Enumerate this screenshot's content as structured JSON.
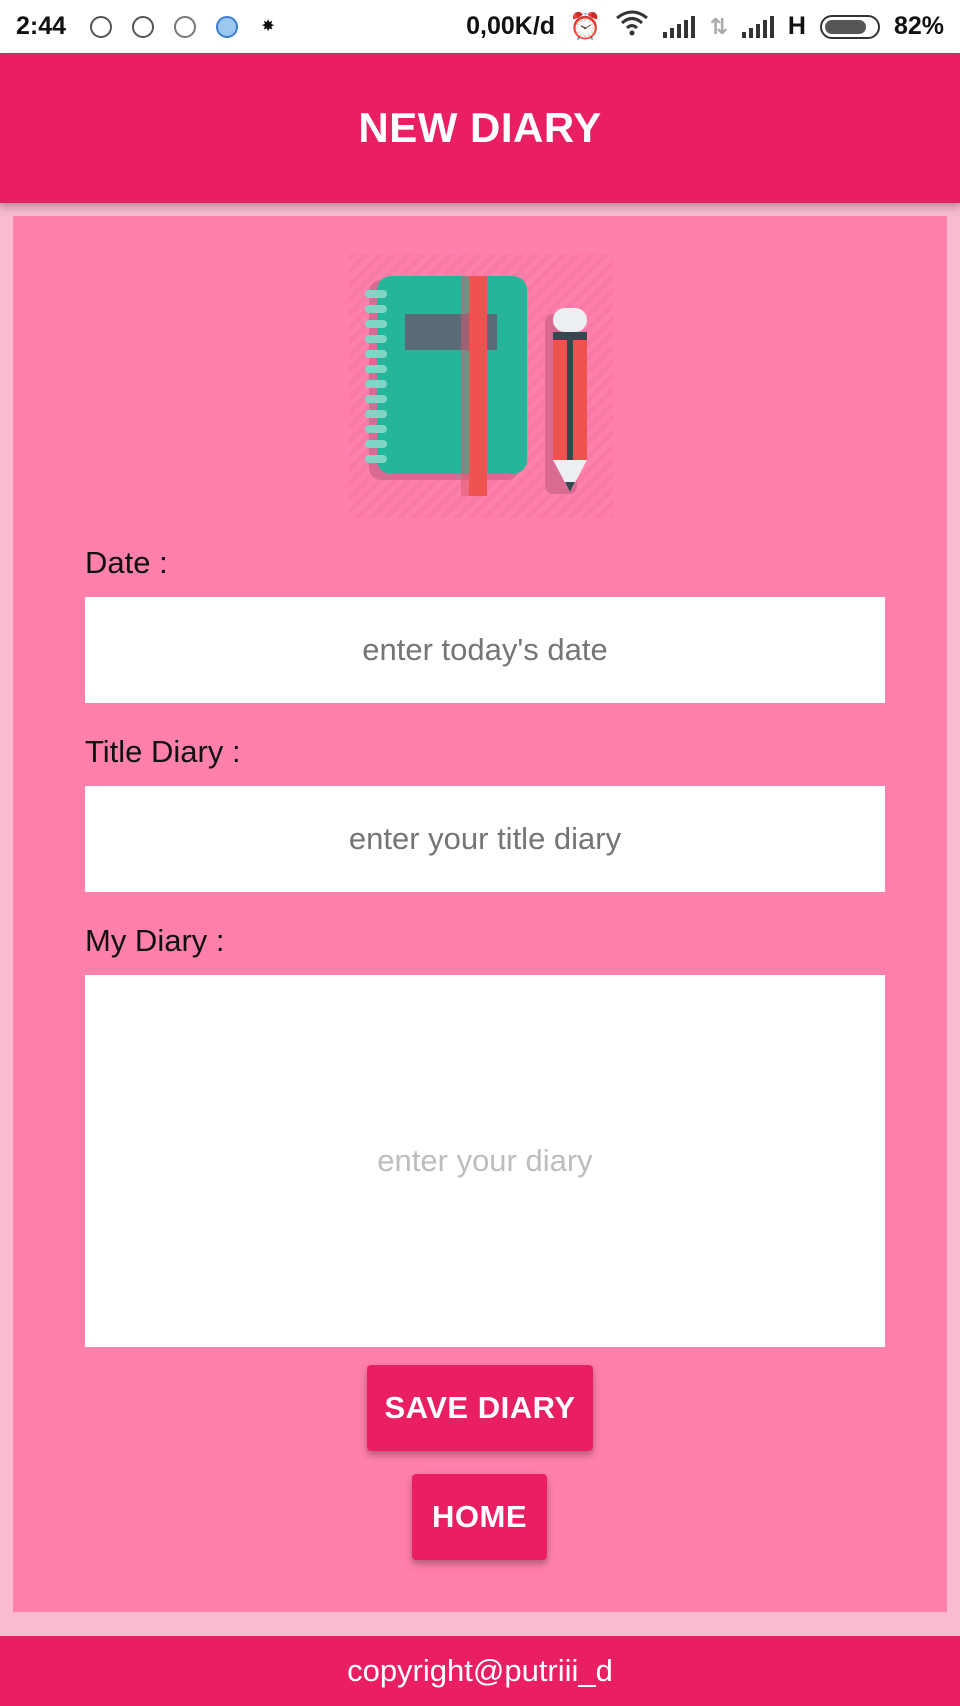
{
  "status_bar": {
    "time": "2:44",
    "network_speed": "0,00K/d",
    "network_type": "H",
    "battery": "82%"
  },
  "app_bar": {
    "title": "NEW DIARY"
  },
  "form": {
    "date_label": "Date :",
    "date_placeholder": "enter today's date",
    "title_label": "Title Diary :",
    "title_placeholder": "enter your title diary",
    "diary_label": "My Diary :",
    "diary_placeholder": "enter your diary"
  },
  "buttons": {
    "save": "SAVE DIARY",
    "home": "HOME"
  },
  "footer": {
    "text": "copyright@putriii_d"
  },
  "colors": {
    "primary": "#e91e63",
    "content_bg": "#ff80ab",
    "page_bg": "#f8bbd0"
  }
}
